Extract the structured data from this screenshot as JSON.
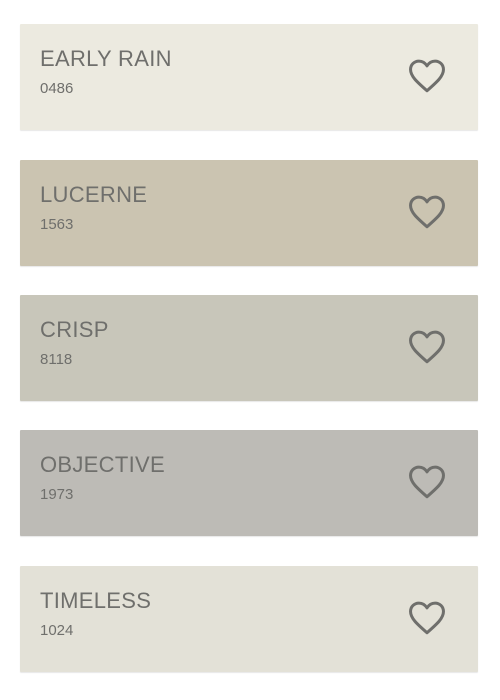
{
  "colors": [
    {
      "name": "EARLY RAIN",
      "code": "0486",
      "swatch": "#eceae0",
      "favorite_icon": "heart-outline-icon"
    },
    {
      "name": "LUCERNE",
      "code": "1563",
      "swatch": "#cbc4b1",
      "favorite_icon": "heart-outline-icon"
    },
    {
      "name": "CRISP",
      "code": "8118",
      "swatch": "#c8c6ba",
      "favorite_icon": "heart-outline-icon"
    },
    {
      "name": "OBJECTIVE",
      "code": "1973",
      "swatch": "#bdbbb6",
      "favorite_icon": "heart-outline-icon"
    },
    {
      "name": "TIMELESS",
      "code": "1024",
      "swatch": "#e3e1d7",
      "favorite_icon": "heart-outline-icon"
    }
  ],
  "text_color": "#6f6f6c",
  "icon_color": "#6f6f6c"
}
